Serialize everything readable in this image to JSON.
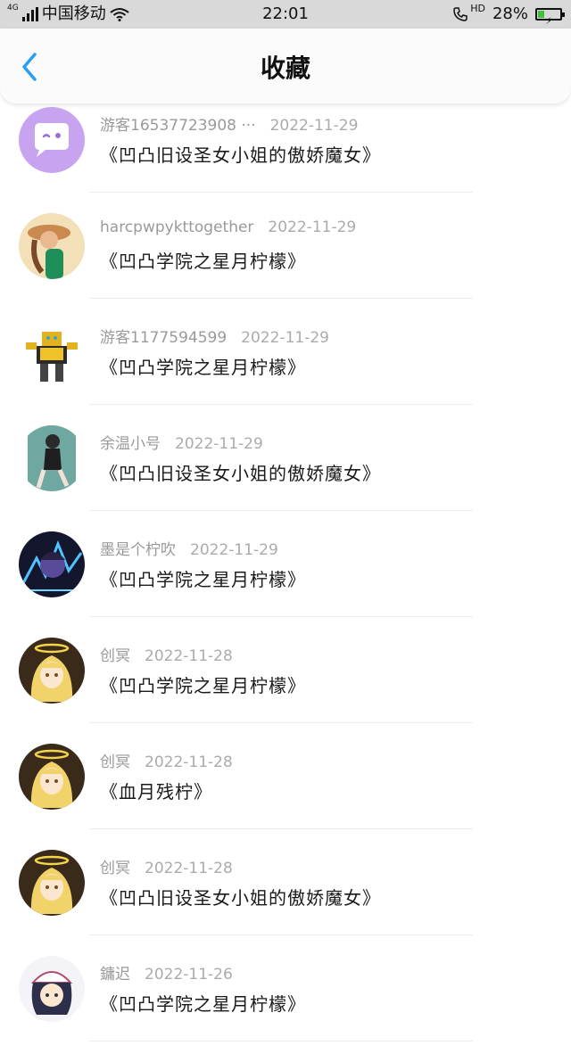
{
  "status_bar": {
    "network_type": "4G",
    "carrier": "中国移动",
    "time": "22:01",
    "call_badge": "HD",
    "battery_percent": "28%",
    "battery_level": 0.28,
    "colors": {
      "battery": "#3cc23c"
    }
  },
  "header": {
    "back_icon": "chevron-left-icon",
    "title": "收藏",
    "accent": "#2a9df4"
  },
  "items": [
    {
      "user": "游客16537723908 ···",
      "date": "2022-11-29",
      "title": "《凹凸旧设圣女小姐的傲娇魔女》",
      "avatar": "chat-bubble-avatar"
    },
    {
      "user": "harcpwpykttogether",
      "date": "2022-11-29",
      "title": "《凹凸学院之星月柠檬》",
      "avatar": "girl-hat-avatar"
    },
    {
      "user": "游客1177594599",
      "date": "2022-11-29",
      "title": "《凹凸学院之星月柠檬》",
      "avatar": "robot-avatar"
    },
    {
      "user": "余温小号",
      "date": "2022-11-29",
      "title": "《凹凸旧设圣女小姐的傲娇魔女》",
      "avatar": "sitting-girl-avatar"
    },
    {
      "user": "墨是个柠吹",
      "date": "2022-11-29",
      "title": "《凹凸学院之星月柠檬》",
      "avatar": "dark-anime-avatar"
    },
    {
      "user": "创冥",
      "date": "2022-11-28",
      "title": "《凹凸学院之星月柠檬》",
      "avatar": "halo-anime-avatar"
    },
    {
      "user": "创冥",
      "date": "2022-11-28",
      "title": "《血月残柠》",
      "avatar": "halo-anime-avatar"
    },
    {
      "user": "创冥",
      "date": "2022-11-28",
      "title": "《凹凸旧设圣女小姐的傲娇魔女》",
      "avatar": "halo-anime-avatar"
    },
    {
      "user": "鏞迟",
      "date": "2022-11-26",
      "title": "《凹凸学院之星月柠檬》",
      "avatar": "cap-anime-avatar"
    }
  ]
}
